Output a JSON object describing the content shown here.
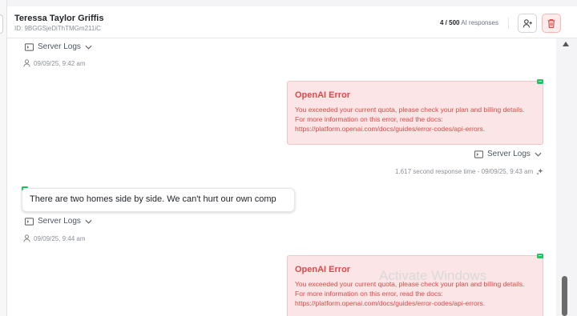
{
  "header": {
    "contact_name": "Teressa Taylor Griffis",
    "contact_id": "ID: 9BGGSjeDiThTMGm211iC",
    "usage_count": "4 / 500",
    "usage_label": "AI responses"
  },
  "messages": [
    {
      "server_logs_label": "Server Logs",
      "timestamp": "09/09/25, 9:42 am"
    },
    {
      "error_title": "OpenAI Error",
      "error_body": "You exceeded your current quota, please check your plan and billing details. For more information on this error, read the docs: https://platform.openai.com/docs/guides/error-codes/api-errors.",
      "server_logs_label": "Server Logs",
      "response_meta": "1.617 second response time - 09/09/25, 9:43 am"
    },
    {
      "text": "There are two homes side by side. We can't hurt our own comp",
      "server_logs_label": "Server Logs",
      "timestamp": "09/09/25, 9:44 am"
    },
    {
      "error_title": "OpenAI Error",
      "error_body": "You exceeded your current quota, please check your plan and billing details. For more information on this error, read the docs: https://platform.openai.com/docs/guides/error-codes/api-errors."
    }
  ],
  "watermark": "Activate Windows",
  "colors": {
    "error_red": "#e04848",
    "error_bg": "#fbe5e6",
    "badge_green": "#22c55e",
    "delete_bg": "#fdecec"
  }
}
